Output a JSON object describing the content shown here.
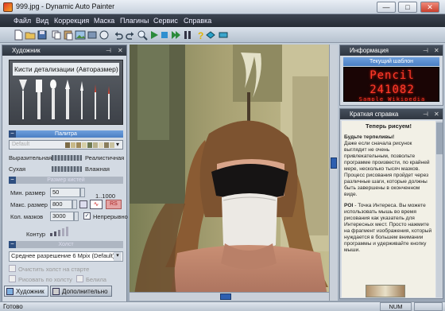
{
  "window": {
    "title": "999.jpg - Dynamic Auto Painter",
    "minimize": "—",
    "maximize": "□",
    "close": "✕"
  },
  "menu": [
    "Файл",
    "Вид",
    "Коррекция",
    "Маска",
    "Плагины",
    "Сервис",
    "Справка"
  ],
  "artist_panel": {
    "title": "Художник",
    "brush_label": "Кисти детализации (Авторазмер)",
    "palette_header": "Палитра",
    "palette_value": "Default",
    "expressive": "Выразительная",
    "realistic": "Реалистичная",
    "dry": "Сухая",
    "wet": "Влажная",
    "brush_size_header": "Размер кистей",
    "min_size_label": "Мин. размер",
    "min_size_value": "50",
    "max_size_label": "Макс. размер",
    "max_size_value": "800",
    "range_label": "1..1000",
    "rs_label": "RS",
    "strokes_label": "Кол. мазков",
    "strokes_value": "3000",
    "continuous_label": "Непрерывно",
    "contour_label": "Контур",
    "canvas_header": "Холст",
    "resolution_value": "Среднее разрешение 6 Mpix (Default)",
    "check1_label": "Очистить холст на старте",
    "check2_label": "Рисовать по холсту",
    "check3_label": "Белила",
    "tab1": "Художник",
    "tab2": "Дополнительно"
  },
  "info_panel": {
    "title": "Информация",
    "template_header": "Текущий шаблон",
    "led_line1": "Pencil",
    "led_line2": "241082",
    "led_line3": "Sample Wikipedia"
  },
  "help_panel": {
    "title": "Краткая справка",
    "heading": "Теперь рисуем!",
    "para1_title": "Будьте терпеливы!",
    "para1": "Даже если сначала рисунок выглядит не очень привлекательным, позвольте программе произвести, по крайней мере, несколько тысяч мазков. Процесс рисования пройдет через различные шаги, которые должны быть завершены в оконченном виде.",
    "para2_title": "POI",
    "para2": " - Точка Интереса. Вы можете использовать мышь во время рисования как указатель для Интересных мест. Просто нажмите на фрагмент изображения, который нуждается в большем внимании программы и удерживайте кнопку мыши."
  },
  "status": {
    "left": "Готово",
    "num": "NUM"
  },
  "colors": {
    "accent": "#4a7fc4",
    "led": "#ff3a2a",
    "menubar": "#2d333d"
  }
}
